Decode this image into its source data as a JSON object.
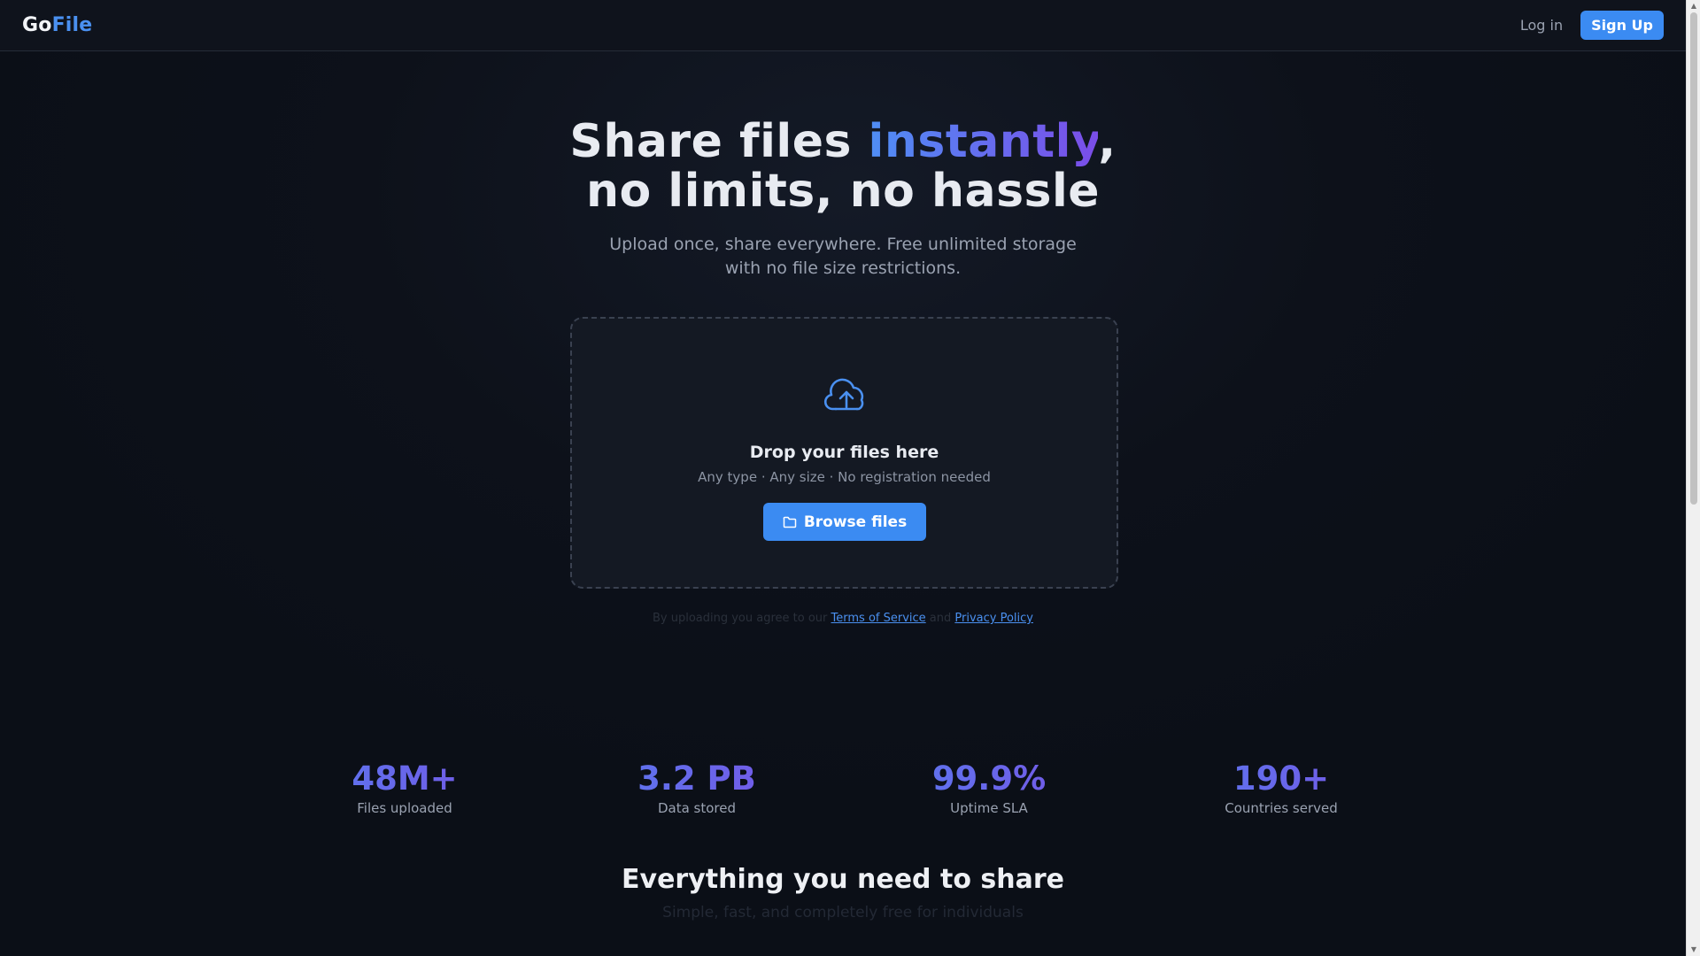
{
  "header": {
    "logo_part1": "Go",
    "logo_part2": "File",
    "login_label": "Log in",
    "signup_label": "Sign Up"
  },
  "hero": {
    "title_line1_a": "Share files ",
    "title_line1_accent": "instantly",
    "title_line1_b": ",",
    "title_line2": "no limits, no hassle",
    "subtitle_line1": "Upload once, share everywhere. Free unlimited storage",
    "subtitle_line2": "with no file size restrictions."
  },
  "dropzone": {
    "icon": "cloud-upload-icon",
    "title": "Drop your files here",
    "subtitle": "Any type · Any size · No registration needed",
    "browse_label": "Browse files",
    "browse_icon": "folder-icon"
  },
  "terms": {
    "prefix": "By uploading you agree to our ",
    "tos_label": "Terms of Service",
    "middle": " and ",
    "privacy_label": "Privacy Policy"
  },
  "stats": [
    {
      "value": "48M+",
      "label": "Files uploaded"
    },
    {
      "value": "3.2 PB",
      "label": "Data stored"
    },
    {
      "value": "99.9%",
      "label": "Uptime SLA"
    },
    {
      "value": "190+",
      "label": "Countries served"
    }
  ],
  "features": {
    "title": "Everything you need to share",
    "subtitle": "Simple, fast, and completely free for individuals"
  },
  "colors": {
    "accent_blue": "#3b8bf2",
    "accent_purple": "#7b4de8",
    "background": "#0b0f17"
  }
}
